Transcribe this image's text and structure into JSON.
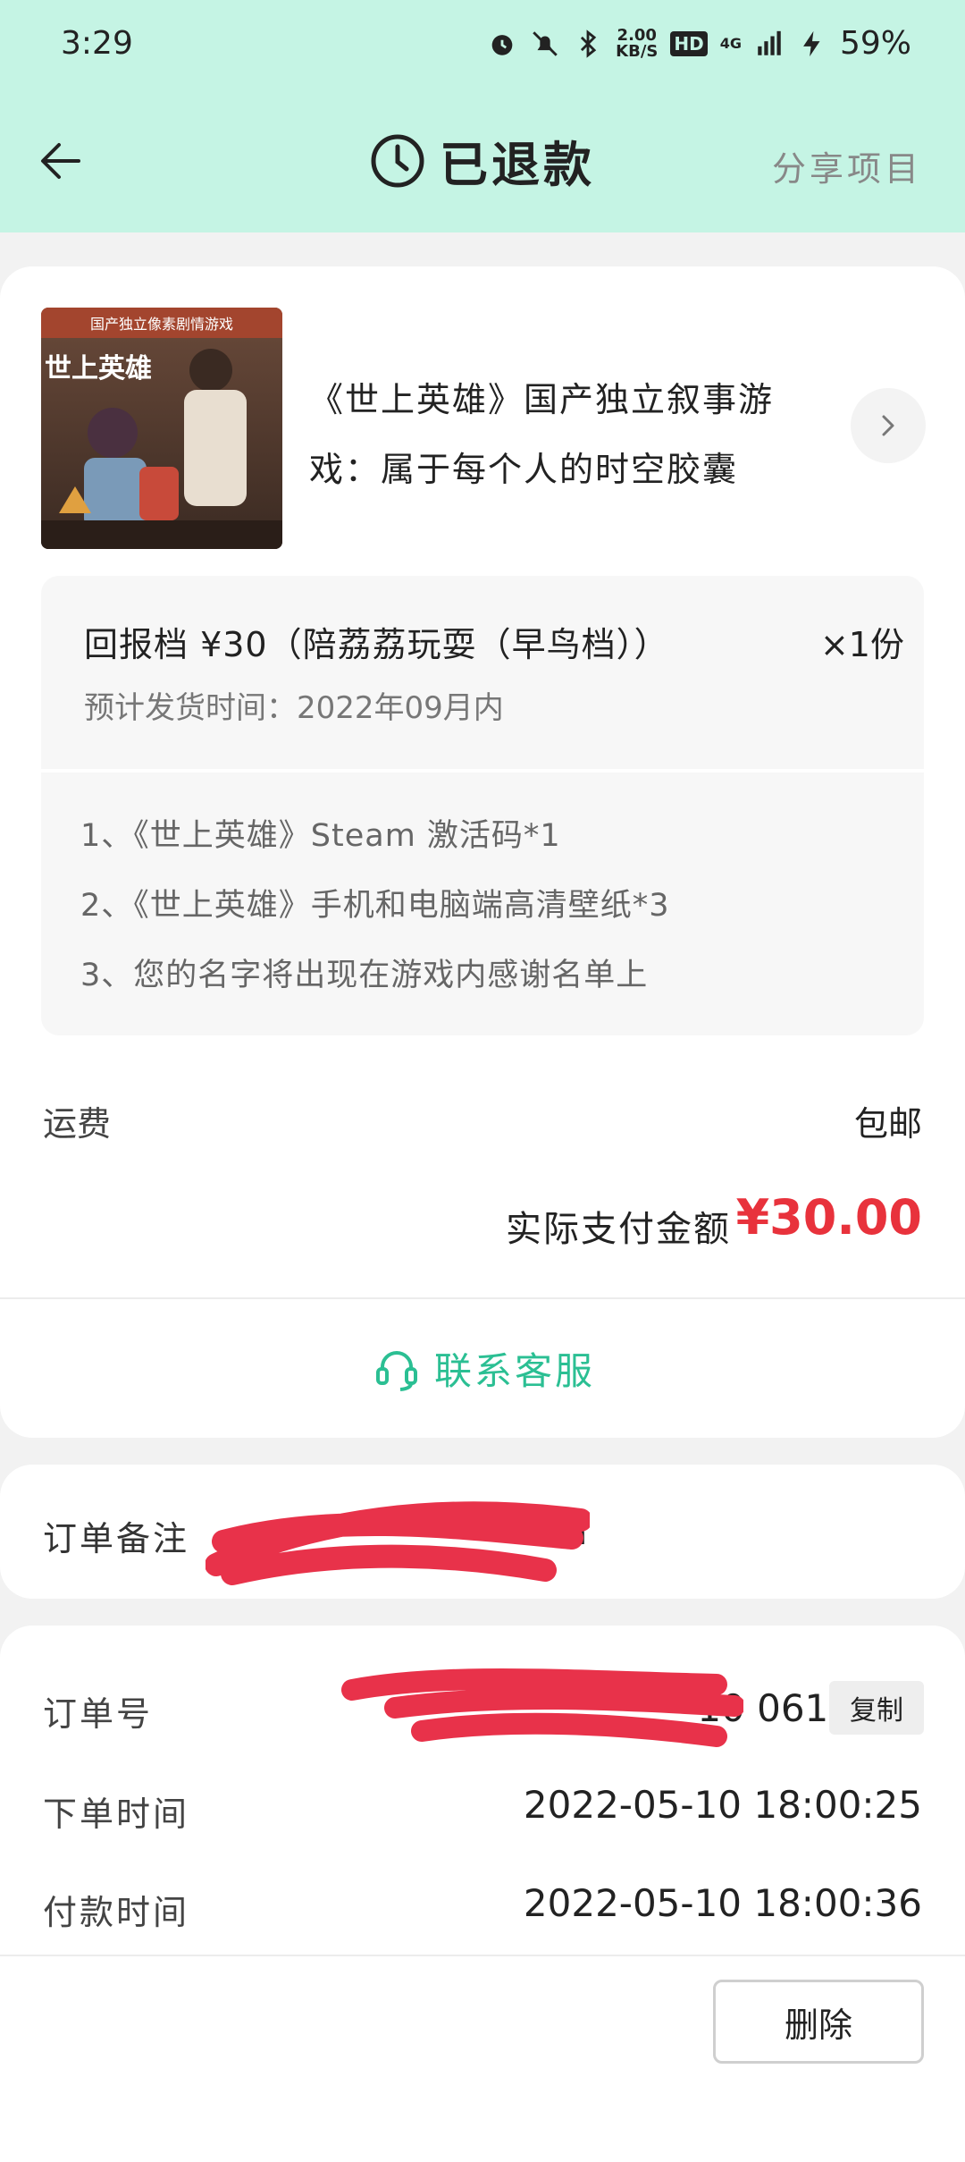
{
  "status_bar": {
    "time": "3:29",
    "speed_value": "2.00",
    "speed_unit": "KB/S",
    "hd": "HD",
    "network": "4G",
    "battery": "59%"
  },
  "header": {
    "title": "已退款",
    "share": "分享项目"
  },
  "product": {
    "title": "《世上英雄》国产独立叙事游戏：属于每个人的时空胶囊",
    "cover_text": "世上英雄",
    "cover_subtitle": "国产独立像素剧情游戏"
  },
  "tier": {
    "label": "回报档  ¥30（陪荔荔玩耍（早鸟档））",
    "quantity": "×1份",
    "ship_time": "预计发货时间：2022年09月内",
    "items": [
      "1、《世上英雄》Steam 激活码*1",
      "2、《世上英雄》手机和电脑端高清壁纸*3",
      "3、您的名字将出现在游戏内感谢名单上"
    ]
  },
  "freight": {
    "label": "运费",
    "value": "包邮"
  },
  "payment": {
    "label": "实际支付金额",
    "value": "¥30.00"
  },
  "contact": {
    "label": "联系客服"
  },
  "remark": {
    "label": "订单备注",
    "value": "m"
  },
  "order": {
    "number_label": "订单号",
    "number_value": "10                    0612",
    "copy_label": "复制",
    "order_time_label": "下单时间",
    "order_time_value": "2022-05-10 18:00:25",
    "pay_time_label": "付款时间",
    "pay_time_value": "2022-05-10 18:00:36"
  },
  "actions": {
    "delete_label": "删除"
  },
  "colors": {
    "header_bg": "#c5f4e4",
    "price_red": "#e8323c",
    "accent_green": "#2bbf93",
    "redaction_red": "#e8324a"
  }
}
